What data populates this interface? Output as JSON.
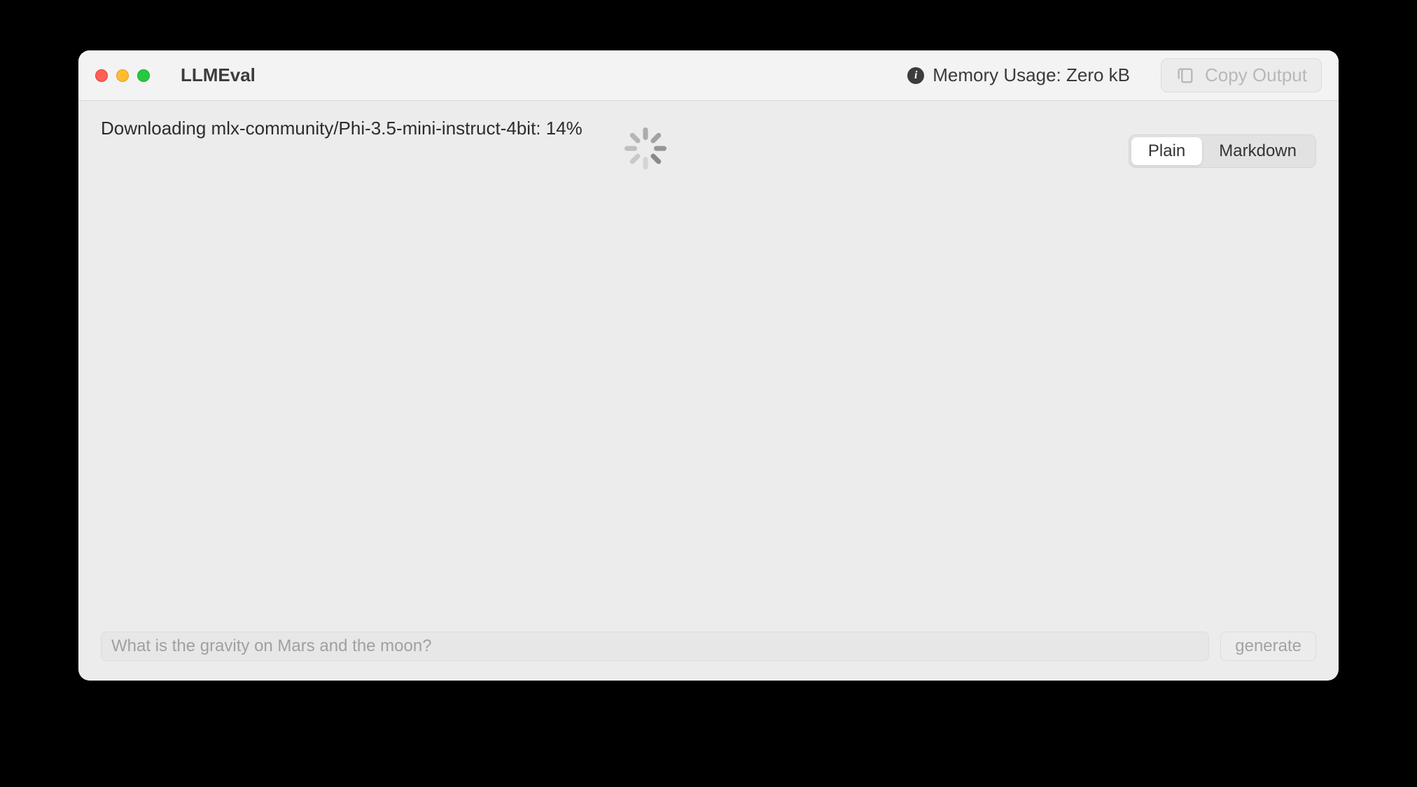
{
  "window": {
    "title": "LLMEval"
  },
  "toolbar": {
    "memory_label": "Memory Usage: Zero kB",
    "copy_label": "Copy Output"
  },
  "status": {
    "download_text": "Downloading mlx-community/Phi-3.5-mini-instruct-4bit: 14%"
  },
  "tabs": {
    "plain": "Plain",
    "markdown": "Markdown",
    "active": "plain"
  },
  "input": {
    "placeholder": "What is the gravity on Mars and the moon?",
    "value": ""
  },
  "buttons": {
    "generate": "generate"
  }
}
